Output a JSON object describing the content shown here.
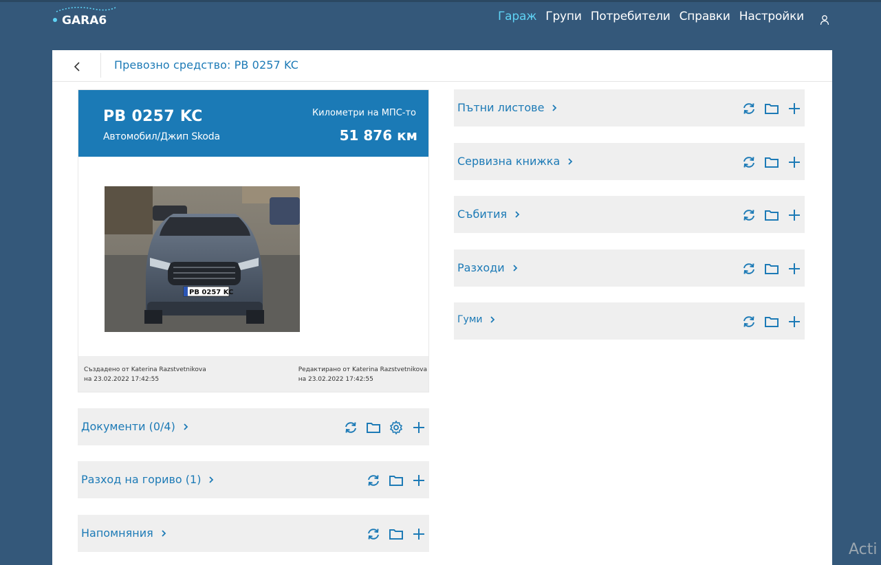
{
  "app": {
    "logo_text": "GARA6"
  },
  "nav": [
    {
      "label": "Гараж",
      "active": true
    },
    {
      "label": "Групи",
      "active": false
    },
    {
      "label": "Потребители",
      "active": false
    },
    {
      "label": "Справки",
      "active": false
    },
    {
      "label": "Настройки",
      "active": false
    }
  ],
  "page": {
    "title": "Превозно средство: PB 0257 KC"
  },
  "vehicle": {
    "plate": "PB 0257 KC",
    "type": "Автомобил/Джип Skoda",
    "km_label": "Километри на МПС-то",
    "km_value": "51 876 км",
    "created": "Създадено от Katerina Razstvetnikova",
    "created_on": "на 23.02.2022 17:42:55",
    "edited": "Редактирано от Katerina Razstvetnikova",
    "edited_on": "на 23.02.2022 17:42:55",
    "photo_plate": "PB 0257 KC"
  },
  "left_sections": [
    {
      "label": "Документи (0/4)",
      "icons": [
        "sync-icon",
        "folder-icon",
        "gear-icon",
        "plus-icon"
      ]
    },
    {
      "label": "Разход на гориво (1)",
      "icons": [
        "sync-icon",
        "folder-icon",
        "plus-icon"
      ]
    },
    {
      "label": "Напомняния",
      "icons": [
        "sync-icon",
        "folder-icon",
        "plus-icon"
      ]
    }
  ],
  "right_sections": [
    {
      "label": "Пътни листове",
      "icons": [
        "sync-icon",
        "folder-icon",
        "plus-icon"
      ]
    },
    {
      "label": "Сервизна книжка",
      "icons": [
        "sync-icon",
        "folder-icon",
        "plus-icon"
      ]
    },
    {
      "label": "Събития",
      "icons": [
        "sync-icon",
        "folder-icon",
        "plus-icon"
      ]
    },
    {
      "label": "Разходи",
      "icons": [
        "sync-icon",
        "folder-icon",
        "plus-icon"
      ]
    },
    {
      "label": "Гуми",
      "icons": [
        "sync-icon",
        "folder-icon",
        "plus-icon"
      ]
    }
  ],
  "watermark": "Acti",
  "colors": {
    "accent": "#1c7ab6",
    "nav_bg": "#34587a",
    "active_nav": "#5fd3f5",
    "section_bg": "#efefef"
  }
}
